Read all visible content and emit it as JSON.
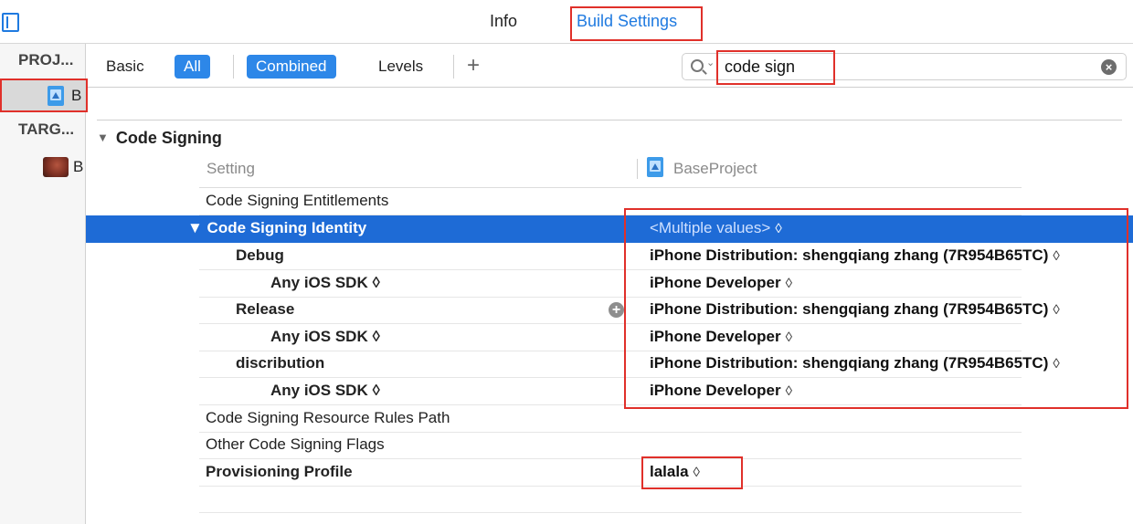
{
  "top_tabs": {
    "info": "Info",
    "build_settings": "Build Settings"
  },
  "sidebar": {
    "project_heading": "PROJ...",
    "project_item": "B",
    "targets_heading": "TARG...",
    "target_item": "B"
  },
  "toolbar": {
    "basic": "Basic",
    "all": "All",
    "combined": "Combined",
    "levels": "Levels",
    "add": "+"
  },
  "search": {
    "value": "code sign",
    "clear_symbol": "×",
    "dropdown_symbol": "⌄"
  },
  "section": {
    "triangle": "▼",
    "title": "Code Signing"
  },
  "columns": {
    "setting": "Setting",
    "project": "BaseProject"
  },
  "rows": [
    {
      "name": "Code Signing Entitlements",
      "value": ""
    },
    {
      "name": "▼ Code Signing Identity",
      "value": "<Multiple values>"
    },
    {
      "name": "Debug",
      "value": "iPhone Distribution: shengqiang zhang (7R954B65TC)"
    },
    {
      "name": "Any iOS SDK ◊",
      "value": "iPhone Developer"
    },
    {
      "name": "Release",
      "value": "iPhone Distribution: shengqiang zhang (7R954B65TC)"
    },
    {
      "name": "Any iOS SDK ◊",
      "value": "iPhone Developer"
    },
    {
      "name": "discribution",
      "value": "iPhone Distribution: shengqiang zhang (7R954B65TC)"
    },
    {
      "name": "Any iOS SDK ◊",
      "value": "iPhone Developer"
    },
    {
      "name": "Code Signing Resource Rules Path",
      "value": ""
    },
    {
      "name": "Other Code Signing Flags",
      "value": ""
    },
    {
      "name": "Provisioning Profile",
      "value": "lalala"
    }
  ],
  "stepper_symbol": "◊",
  "add_condition_symbol": "+",
  "colors": {
    "accent": "#1f7ae0",
    "selection": "#1e6bd6",
    "highlight_box": "#e0302a"
  }
}
